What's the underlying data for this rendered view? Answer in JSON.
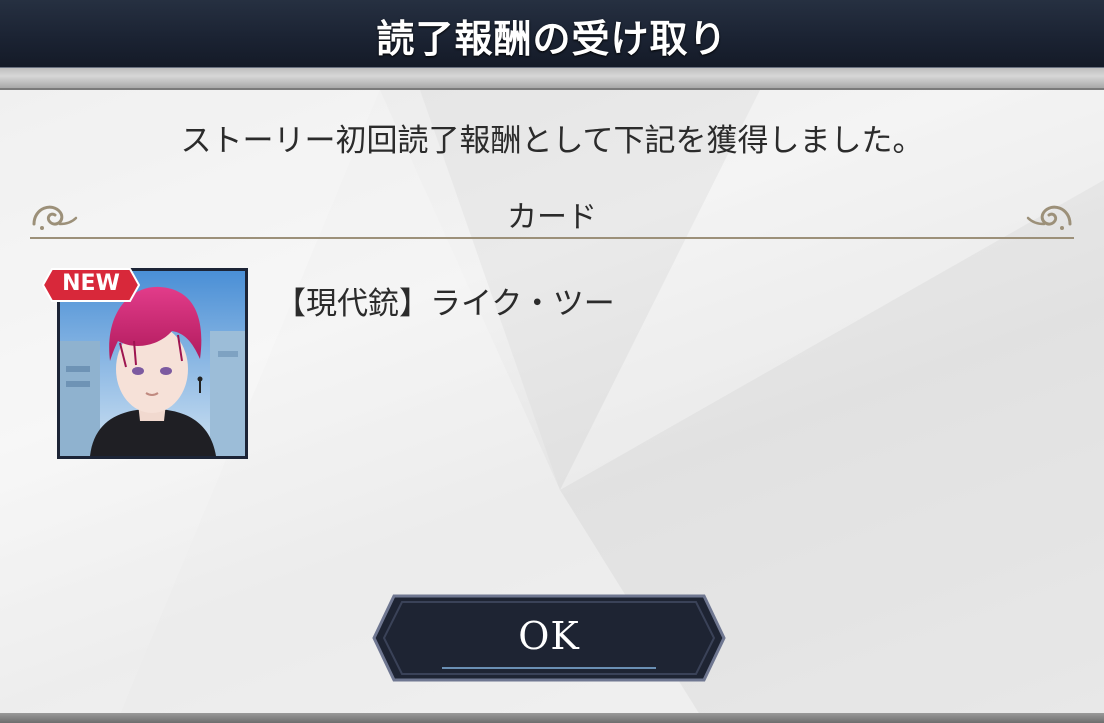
{
  "dialog": {
    "title": "読了報酬の受け取り",
    "message": "ストーリー初回読了報酬として下記を獲得しました。",
    "section_label": "カード",
    "reward": {
      "badge": "NEW",
      "name": "【現代銃】ライク・ツー"
    },
    "ok_label": "OK"
  },
  "colors": {
    "titlebar": "#1b2333",
    "panel": "#ececec",
    "badge": "#d8283a",
    "button": "#1e2433",
    "ornament": "#9c9079"
  }
}
